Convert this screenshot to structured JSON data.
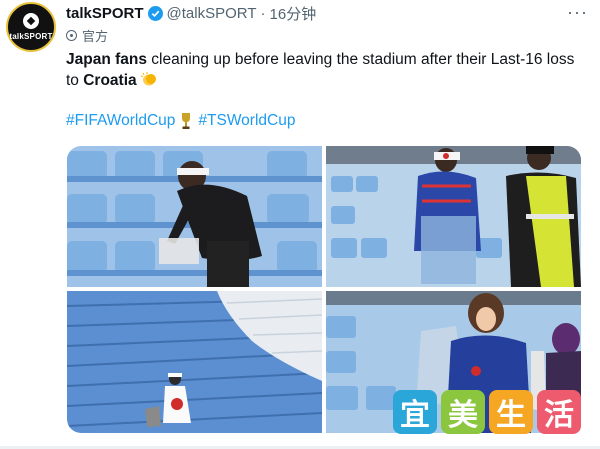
{
  "account": {
    "name": "talkSPORT",
    "handle": "@talkSPORT",
    "separator": "·",
    "time": "16分钟",
    "badge": "官方",
    "avatar_text": "talkSPORT"
  },
  "tweet": {
    "bold_lead": "Japan fans",
    "text_mid": " cleaning up before leaving the stadium after their Last-16 loss to ",
    "bold_tail": "Croatia",
    "hashtags": [
      "#FIFAWorldCup",
      "#TSWorldCup"
    ]
  },
  "media": [
    {
      "name": "fan-with-headband-picking-litter"
    },
    {
      "name": "fans-bagging-trash-with-steward"
    },
    {
      "name": "fan-with-flag-in-empty-stands"
    },
    {
      "name": "female-fan-holding-trash-bag"
    }
  ],
  "watermark": {
    "chars": [
      "宜",
      "美",
      "生",
      "活"
    ],
    "colors": [
      "#2aa7d8",
      "#8cc63f",
      "#f5a623",
      "#ef5b6e"
    ]
  },
  "colors": {
    "link": "#1d9bf0",
    "verified": "#1d9bf0",
    "seat_blue": "#5b8fd1",
    "seat_white": "#e9edf2"
  },
  "icons": {
    "verified": "verified-badge-icon",
    "more": "more-options-icon",
    "official": "official-label-icon",
    "clap": "clapping-hands-icon",
    "trophy": "trophy-icon"
  }
}
